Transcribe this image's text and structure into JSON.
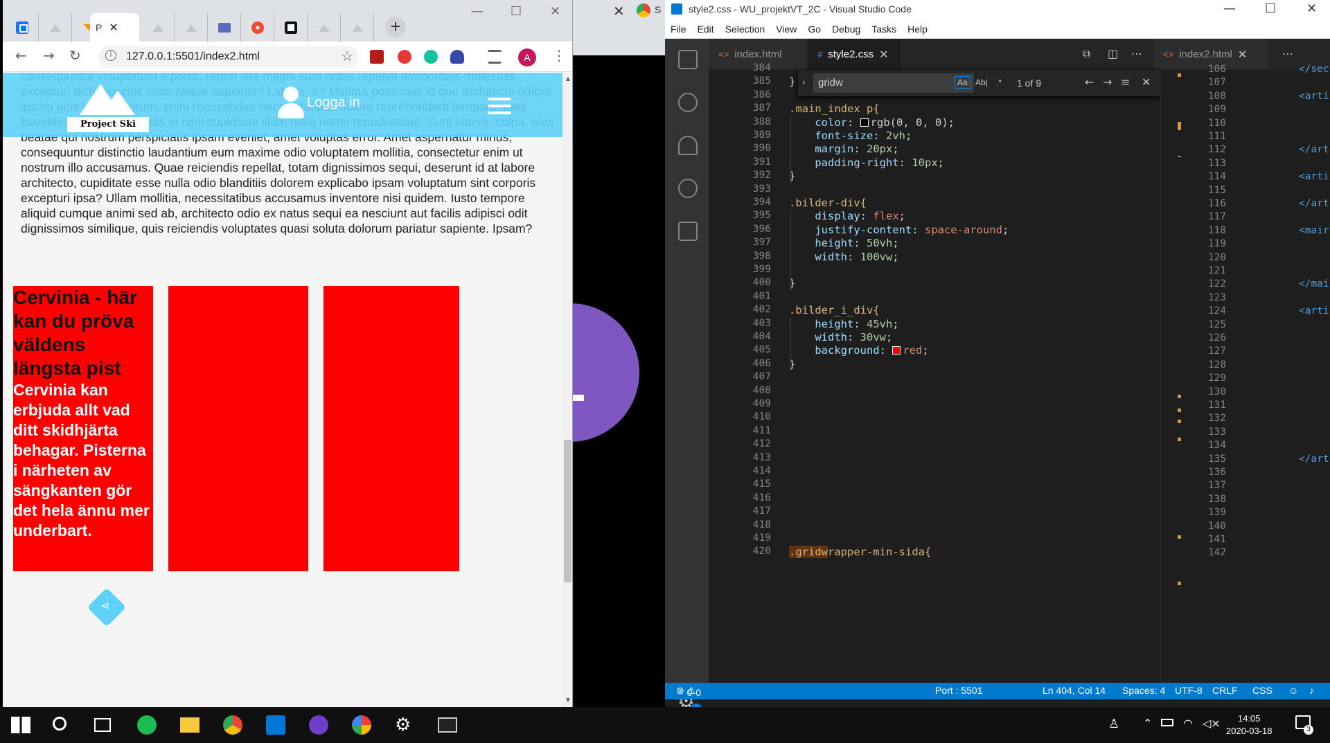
{
  "browser": {
    "active_tab_label": "P",
    "url": "127.0.0.1:5501/index2.html",
    "background_tab_label": "S"
  },
  "page": {
    "paragraph": "consequuntur voluptatum a porro, rerum iste magni sunt nobis repellat temporibus molestias excepturi dicta suscipit iusto itaque sapiente? Labore, a? Minima possimus id quo architecto officiis ipsam quis vero, laborum, enim recusandae necessitatibus dolore reprehenderit tempora quae blanditiis eveniet reiciendis et nihil cupiditate illum nulla nemo repudiandae. Sunt labore, culpa, eius beatae qui nostrum perspiciatis ipsam eveniet, amet voluptas error. Amet aspernatur minus, consequuntur distinctio laudantium eum maxime odio voluptatem mollitia, consectetur enim ut nostrum illo accusamus. Quae reiciendis repellat, totam dignissimos sequi, deserunt id at labore architecto, cupiditate esse nulla odio blanditiis dolorem explicabo ipsam voluptatum sint corporis excepturi ipsa? Ullam mollitia, necessitatibus accusamus inventore nisi quidem. Iusto tempore aliquid cumque animi sed ab, architecto odio ex natus sequi ea nesciunt aut facilis adipisci odit dignissimos similique, quis reiciendis voluptates quasi soluta dolorum pariatur sapiente. Ipsam?",
    "logo_text": "Project Ski",
    "login_label": "Logga in",
    "card1_title": "Cervinia - här kan du pröva väldens längsta pist",
    "card1_text": "Cervinia kan erbjuda allt vad ditt skidhjärta behagar. Pisterna i närheten av sängkanten gör det hela ännu mer underbart."
  },
  "vscode": {
    "title": "style2.css - WU_projektVT_2C - Visual Studio Code",
    "menu": [
      "File",
      "Edit",
      "Selection",
      "View",
      "Go",
      "Debug",
      "Tasks",
      "Help"
    ],
    "tabs": [
      "index.html",
      "style2.css",
      "index2.html"
    ],
    "find": {
      "query": "gridw",
      "case": "Aa",
      "word": "Ab|",
      "regex": ".*",
      "count": "1 of 9"
    },
    "status": {
      "errors": "0",
      "warnings": "0",
      "port": "Port : 5501",
      "position": "Ln 404, Col 14",
      "spaces": "Spaces: 4",
      "encoding": "UTF-8",
      "eol": "CRLF",
      "language": "CSS"
    },
    "badge": "1"
  },
  "code_lines": [
    {
      "n": "384",
      "t": ""
    },
    {
      "n": "385",
      "t": "}"
    },
    {
      "n": "386",
      "t": ""
    },
    {
      "n": "387",
      "t": ".main_index p{"
    },
    {
      "n": "388",
      "t": "    color: rgb(0, 0, 0);"
    },
    {
      "n": "389",
      "t": "    font-size: 2vh;"
    },
    {
      "n": "390",
      "t": "    margin: 20px;"
    },
    {
      "n": "391",
      "t": "    padding-right: 10px;"
    },
    {
      "n": "392",
      "t": "}"
    },
    {
      "n": "393",
      "t": ""
    },
    {
      "n": "394",
      "t": ".bilder-div{"
    },
    {
      "n": "395",
      "t": "    display: flex;"
    },
    {
      "n": "396",
      "t": "    justify-content: space-around;"
    },
    {
      "n": "397",
      "t": "    height: 50vh;"
    },
    {
      "n": "398",
      "t": "    width: 100vw;"
    },
    {
      "n": "399",
      "t": ""
    },
    {
      "n": "400",
      "t": "}"
    },
    {
      "n": "401",
      "t": ""
    },
    {
      "n": "402",
      "t": ".bilder_i_div{"
    },
    {
      "n": "403",
      "t": "    height: 45vh;"
    },
    {
      "n": "404",
      "t": "    width: 30vw;"
    },
    {
      "n": "405",
      "t": "    background: red;"
    },
    {
      "n": "406",
      "t": "}"
    },
    {
      "n": "407",
      "t": ""
    },
    {
      "n": "408",
      "t": ""
    },
    {
      "n": "409",
      "t": ""
    },
    {
      "n": "410",
      "t": ""
    },
    {
      "n": "411",
      "t": ""
    },
    {
      "n": "412",
      "t": ""
    },
    {
      "n": "413",
      "t": ""
    },
    {
      "n": "414",
      "t": ""
    },
    {
      "n": "415",
      "t": ""
    },
    {
      "n": "416",
      "t": ""
    },
    {
      "n": "417",
      "t": ""
    },
    {
      "n": "418",
      "t": ""
    },
    {
      "n": "419",
      "t": ""
    },
    {
      "n": "420",
      "t": ".gridwrapper-min-sida{"
    }
  ],
  "right_lines": [
    {
      "n": "106",
      "t": "</sec"
    },
    {
      "n": "107",
      "t": ""
    },
    {
      "n": "108",
      "t": "<arti"
    },
    {
      "n": "109",
      "t": ""
    },
    {
      "n": "110",
      "t": ""
    },
    {
      "n": "111",
      "t": ""
    },
    {
      "n": "112",
      "t": "</art"
    },
    {
      "n": "113",
      "t": ""
    },
    {
      "n": "114",
      "t": "<arti"
    },
    {
      "n": "115",
      "t": ""
    },
    {
      "n": "116",
      "t": "</art"
    },
    {
      "n": "117",
      "t": ""
    },
    {
      "n": "118",
      "t": "<mair"
    },
    {
      "n": "119",
      "t": ""
    },
    {
      "n": "120",
      "t": ""
    },
    {
      "n": "121",
      "t": ""
    },
    {
      "n": "122",
      "t": "</mai"
    },
    {
      "n": "123",
      "t": ""
    },
    {
      "n": "124",
      "t": "<arti"
    },
    {
      "n": "125",
      "t": ""
    },
    {
      "n": "126",
      "t": ""
    },
    {
      "n": "127",
      "t": ""
    },
    {
      "n": "128",
      "t": ""
    },
    {
      "n": "129",
      "t": ""
    },
    {
      "n": "130",
      "t": ""
    },
    {
      "n": "131",
      "t": ""
    },
    {
      "n": "132",
      "t": ""
    },
    {
      "n": "133",
      "t": ""
    },
    {
      "n": "134",
      "t": ""
    },
    {
      "n": "135",
      "t": "</art"
    },
    {
      "n": "136",
      "t": ""
    },
    {
      "n": "137",
      "t": ""
    },
    {
      "n": "138",
      "t": ""
    },
    {
      "n": "139",
      "t": ""
    },
    {
      "n": "140",
      "t": ""
    },
    {
      "n": "141",
      "t": ""
    },
    {
      "n": "142",
      "t": ""
    }
  ],
  "taskbar": {
    "time": "14:05",
    "date": "2020-03-18",
    "notif": "3"
  },
  "colors": {
    "card": "#ff0000",
    "header": "#5fd2fa",
    "status": "#007acc"
  }
}
